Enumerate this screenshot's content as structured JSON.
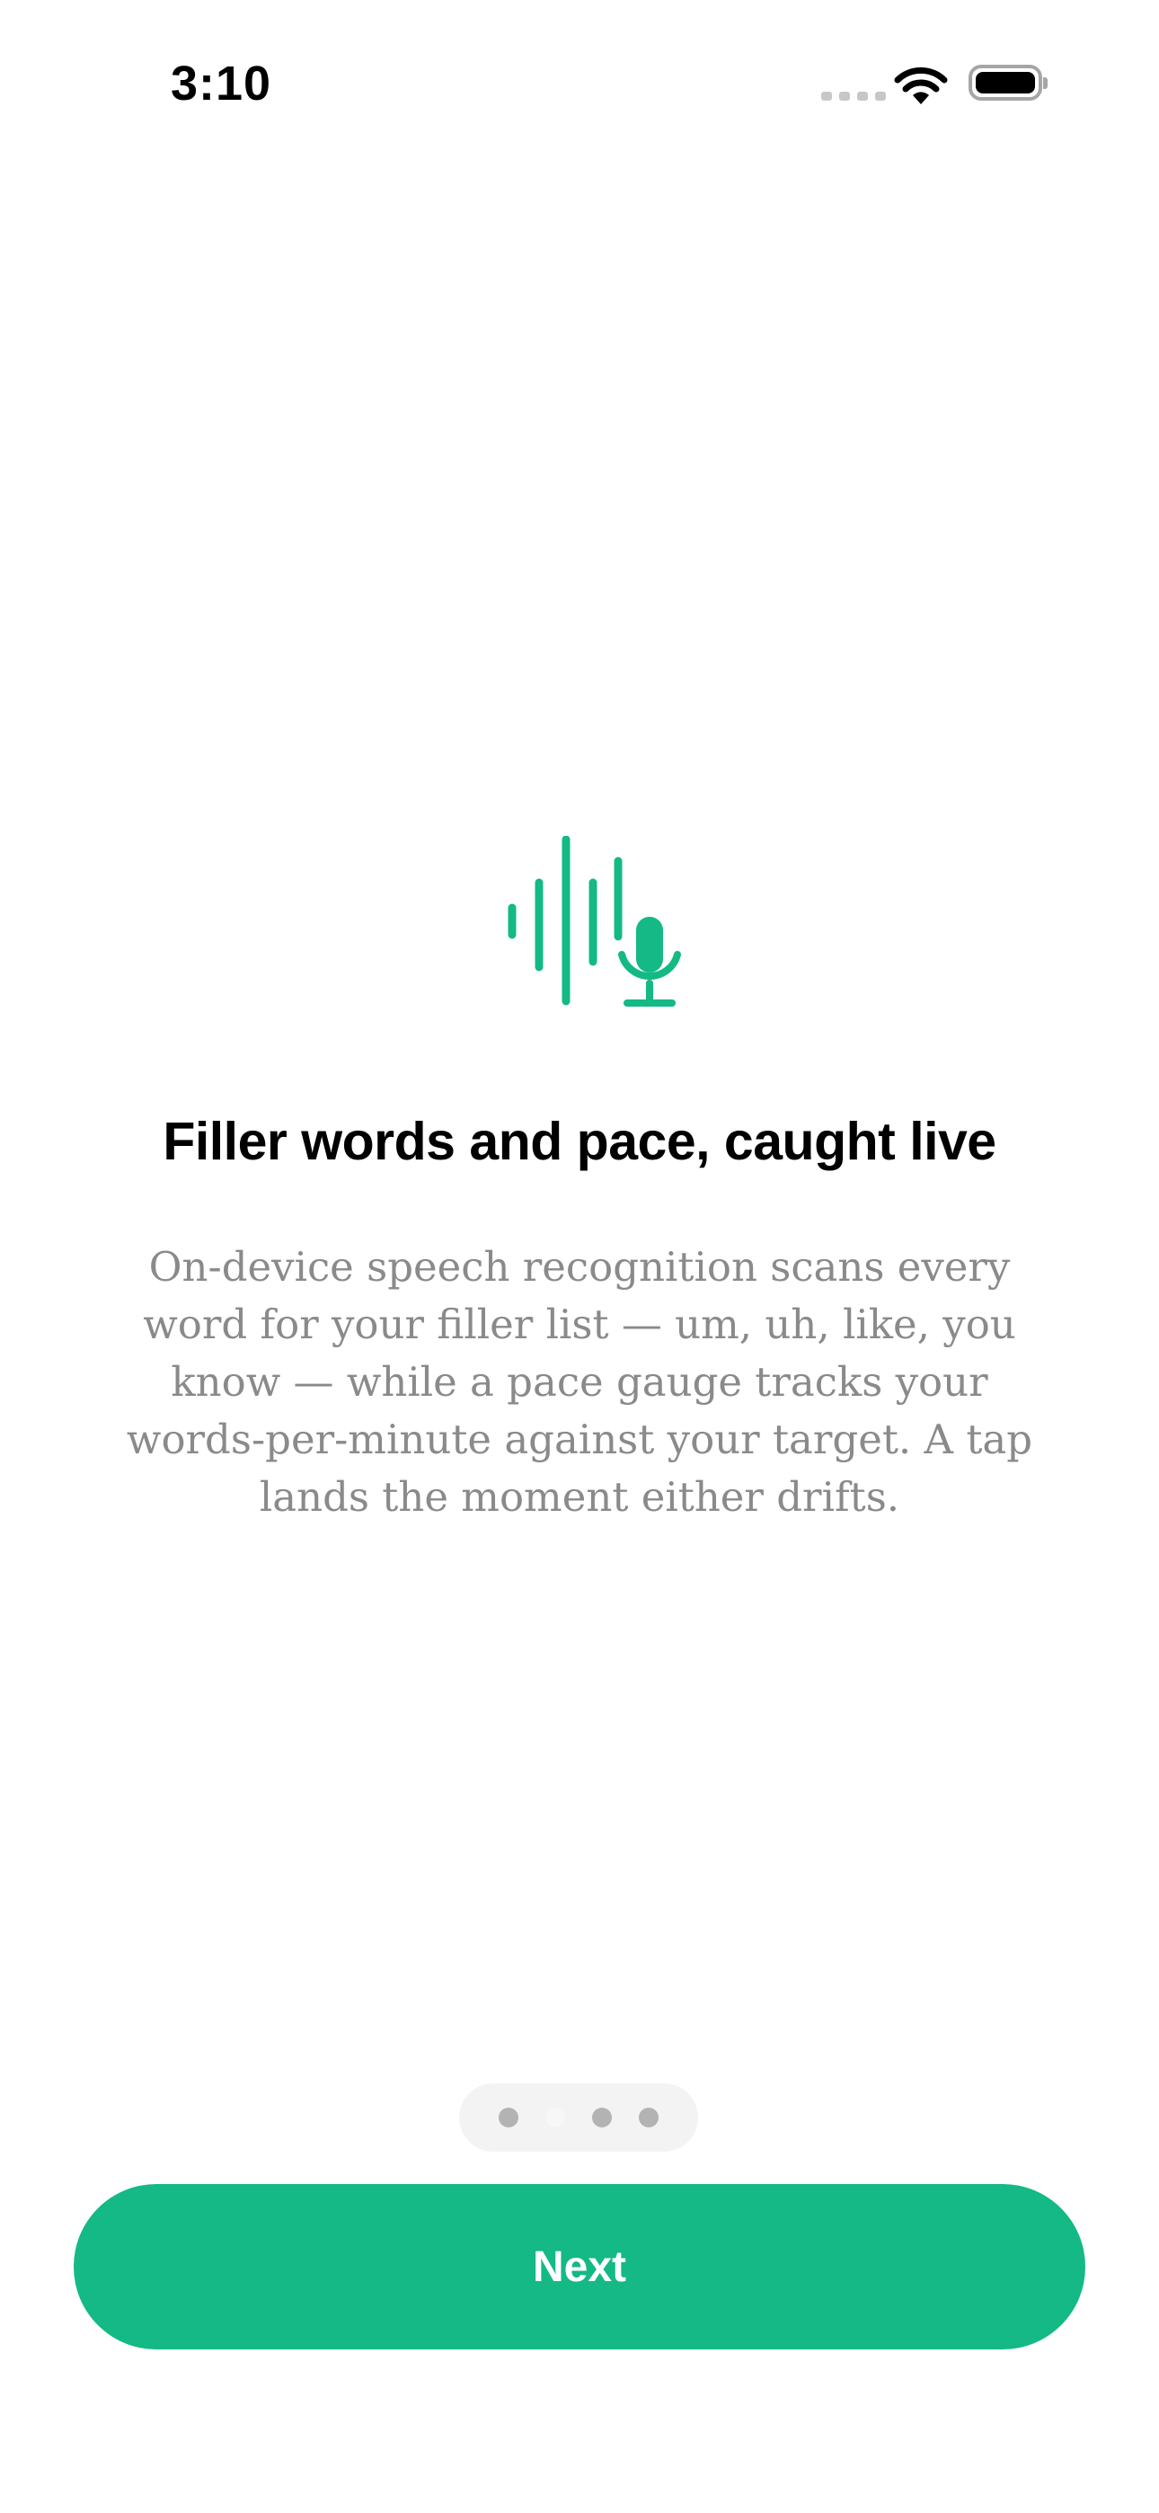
{
  "status_bar": {
    "time": "3:10",
    "icons": [
      "cellular-signal-icon",
      "wifi-icon",
      "battery-icon"
    ]
  },
  "onboarding": {
    "icon": "waveform-microphone-icon",
    "accent_color": "#14b985",
    "title": "Filler words and pace, caught live",
    "body": "On-device speech recognition scans every word for your filler list — um, uh, like, you know — while a pace gauge tracks your words-per-minute against your target. A tap lands the moment either drifts.",
    "page_indicator": {
      "total": 4,
      "current": 2
    },
    "next_label": "Next"
  }
}
